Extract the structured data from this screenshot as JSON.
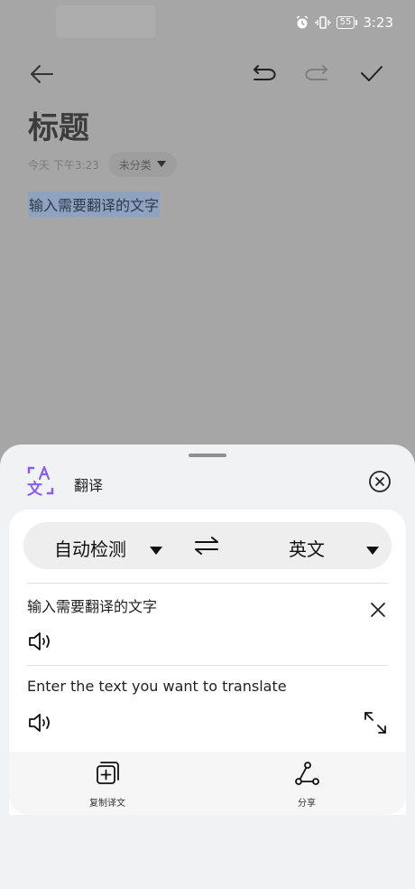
{
  "status_bar": {
    "time": "3:23",
    "battery": "55",
    "icons": [
      "alarm-icon",
      "vibrate-icon",
      "battery-icon"
    ]
  },
  "toolbar": {
    "icons": [
      "back-arrow-icon",
      "undo-icon",
      "redo-icon",
      "check-icon"
    ]
  },
  "note": {
    "title": "标题",
    "date": "今天 下午3:23",
    "category": "未分类",
    "body": "输入需要翻译的文字"
  },
  "sheet": {
    "title": "翻译",
    "source_lang": "自动检测",
    "target_lang": "英文",
    "source_text": "输入需要翻译的文字",
    "translated_text": "Enter the text you want to translate",
    "actions": [
      {
        "label": "复制译文",
        "icon": "copy-translation-icon"
      },
      {
        "label": "分享",
        "icon": "share-icon"
      }
    ]
  },
  "colors": {
    "dim_background": "#a6a6a6",
    "sheet_background": "#f1f2f4",
    "card_background": "#ffffff",
    "accent_purple": "#8b5cf6",
    "text_highlight": "#8fa2bf"
  }
}
